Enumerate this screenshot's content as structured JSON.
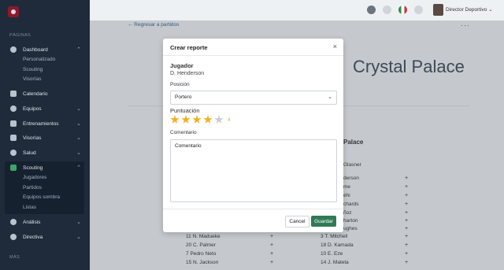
{
  "sidebar": {
    "section_pages": "PÁGINAS",
    "section_more": "MÁS",
    "items": [
      {
        "label": "Dashboard"
      },
      {
        "label": "Calendario"
      },
      {
        "label": "Equipos"
      },
      {
        "label": "Entrenamientos"
      },
      {
        "label": "Visorías"
      },
      {
        "label": "Salud"
      },
      {
        "label": "Scouting"
      },
      {
        "label": "Análisis"
      },
      {
        "label": "Directiva"
      }
    ],
    "dashboard_sub": [
      "Personalizado",
      "Scouting",
      "Visorías"
    ],
    "scouting_sub": [
      "Jugadores",
      "Partidos",
      "Equipos sombra",
      "Listas"
    ]
  },
  "topbar": {
    "user_label": "Director Deportivo",
    "chevron": "⌄"
  },
  "page": {
    "back_link": "← Regresar a partidos",
    "more": "···",
    "team_title": "Crystal Palace",
    "team_subtitle": "Palace",
    "left_rows": [
      {
        "num": "11",
        "name": "N. Madueke"
      },
      {
        "num": "20",
        "name": "C. Palmer"
      },
      {
        "num": "7",
        "name": "Pedro Neto"
      },
      {
        "num": "15",
        "name": "N. Jackson"
      }
    ],
    "right_partial": [
      "Glasner",
      "derson",
      "me",
      "éhi",
      "chards",
      "ñoz",
      "harton",
      "ughes"
    ],
    "right_rows": [
      {
        "num": "3",
        "name": "T. Mitchell"
      },
      {
        "num": "18",
        "name": "D. Kamada"
      },
      {
        "num": "10",
        "name": "E. Eze"
      },
      {
        "num": "14",
        "name": "J. Mateta"
      }
    ],
    "plus": "+"
  },
  "modal": {
    "title": "Crear reporte",
    "close": "×",
    "jugador_label": "Jugador",
    "jugador_value": "D. Henderson",
    "posicion_label": "Posición",
    "posicion_value": "Portero",
    "puntuacion_label": "Puntuación",
    "rating": 4,
    "rating_max": 5,
    "rating_text": "4",
    "comentario_label": "Comentario",
    "comentario_value": "Comentario",
    "cancel": "Cancel",
    "save": "Guardar"
  },
  "colors": {
    "sidebar_bg": "#1f2b3a",
    "accent_green": "#2f7a55",
    "star": "#f2b01e"
  }
}
